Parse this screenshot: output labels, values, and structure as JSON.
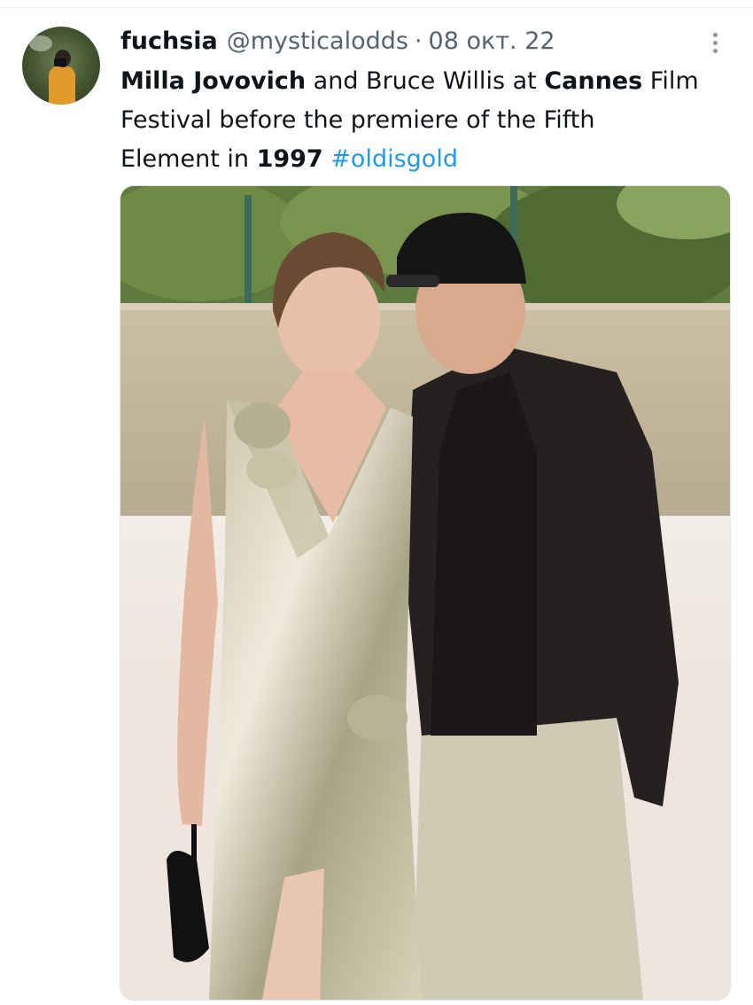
{
  "tweet": {
    "author": {
      "display_name": "fuchsia",
      "handle": "@mysticalodds",
      "separator": "·",
      "date": "08 окт. 22"
    },
    "text": {
      "line1": {
        "s1": "Milla Jovovich",
        "s2": " and Bruce Willis at ",
        "s3": "Cannes",
        "s4": " Film"
      },
      "line2": "Festival before the premiere of the Fifth",
      "line3": {
        "s1": "Element in ",
        "s2": "1997",
        "s3": " ",
        "hashtag": "#oldisgold"
      }
    },
    "icons": {
      "more": "more-vertical-icon",
      "avatar": "user-avatar"
    },
    "colors": {
      "primary_text": "#0f1419",
      "secondary_text": "#536471",
      "hashtag": "#1d9bf0"
    }
  }
}
